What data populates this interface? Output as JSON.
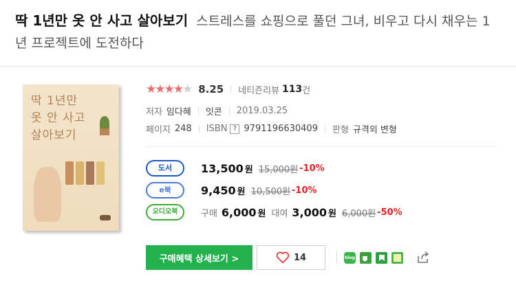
{
  "book": {
    "title": "딱 1년만 옷 안 사고 살아보기",
    "subtitle": "스트레스를 쇼핑으로 풀던 그녀, 비우고 다시 채우는 1년 프로젝트에 도전하다",
    "cover_title_lines": [
      "딱 1년만",
      "옷 안 사고",
      "살아보기"
    ]
  },
  "rating": {
    "stars_filled": 4,
    "stars_total": 5,
    "score": "8.25",
    "review_label": "네티즌리뷰",
    "review_count": "113",
    "review_unit": "건",
    "star_color": "#f06b6b"
  },
  "info": {
    "author_label": "저자",
    "author": "임다혜",
    "publisher": "잇콘",
    "date": "2019.03.25",
    "pages_label": "페이지",
    "pages": "248",
    "isbn_label": "ISBN",
    "isbn_help": "?",
    "isbn": "9791196630409",
    "format_label": "판형",
    "format": "규격외 변형"
  },
  "prices": {
    "book": {
      "badge": "도서",
      "price": "13,500",
      "won": "원",
      "original": "15,000원",
      "discount": "-10%"
    },
    "ebook": {
      "badge": "e북",
      "price": "9,450",
      "won": "원",
      "original": "10,500원",
      "discount": "-10%"
    },
    "audio": {
      "badge": "오디오북",
      "buy_label": "구매",
      "buy_price": "6,000",
      "won": "원",
      "rent_label": "대여",
      "rent_price": "3,000",
      "original": "6,000원",
      "discount": "-50%"
    }
  },
  "actions": {
    "buy_button": "구매혜택 상세보기 >",
    "like_count": "14",
    "accent": "#22b14c",
    "share_icons": [
      "blog-icon",
      "cafe-icon",
      "kakao-page-icon",
      "note-icon",
      "share-icon"
    ]
  }
}
